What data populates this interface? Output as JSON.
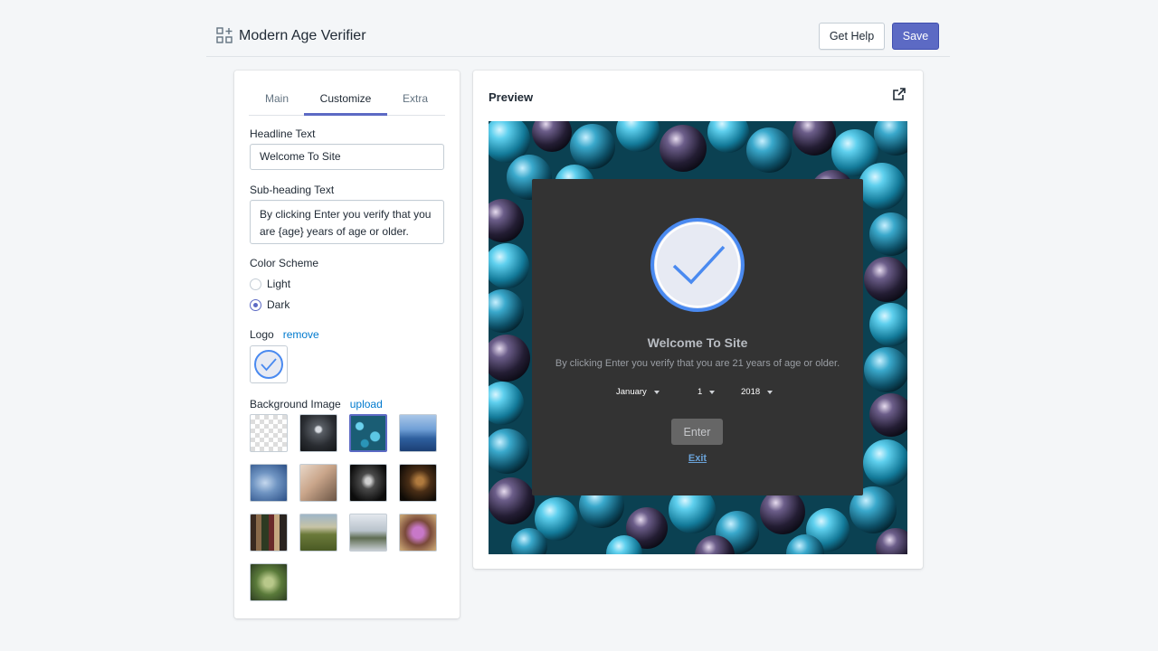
{
  "header": {
    "title": "Modern Age Verifier",
    "help_label": "Get Help",
    "save_label": "Save"
  },
  "tabs": [
    {
      "label": "Main",
      "active": false
    },
    {
      "label": "Customize",
      "active": true
    },
    {
      "label": "Extra",
      "active": false
    }
  ],
  "form": {
    "headline_label": "Headline Text",
    "headline_value": "Welcome To Site",
    "subheading_label": "Sub-heading Text",
    "subheading_value": "By clicking Enter you verify that you are {age} years of age or older.",
    "color_scheme_label": "Color Scheme",
    "color_options": [
      {
        "label": "Light",
        "checked": false
      },
      {
        "label": "Dark",
        "checked": true
      }
    ],
    "logo_label": "Logo",
    "logo_remove": "remove",
    "bg_label": "Background Image",
    "bg_upload": "upload",
    "selected_background": 3
  },
  "preview": {
    "title": "Preview",
    "headline": "Welcome To Site",
    "subheading": "By clicking Enter you verify that you are 21 years of age or older.",
    "month": "January",
    "day": "1",
    "year": "2018",
    "enter_label": "Enter",
    "exit_label": "Exit"
  },
  "colors": {
    "accent": "#5c6ac4",
    "link": "#007ace",
    "modal_bg": "#333333",
    "logo_blue": "#4a8af0"
  }
}
